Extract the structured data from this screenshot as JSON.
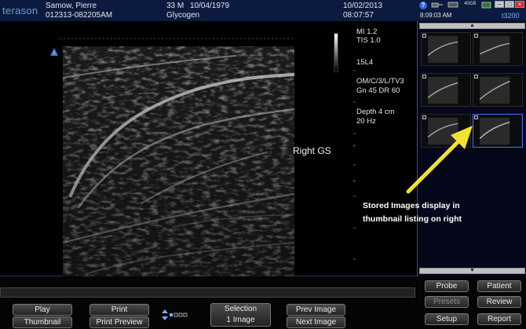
{
  "header": {
    "brand": "terason",
    "patient_name": "Samow, Pierre",
    "patient_id": "012313-082205AM",
    "age": "33 M",
    "dob": "10/04/1979",
    "study": "Glycogen",
    "date": "10/02/2013",
    "time": "08:07:57"
  },
  "status": {
    "clock": "8:09:03 AM",
    "disk": "40GB",
    "model": "t3200"
  },
  "params": {
    "mi": "MI  1.2",
    "tis": "TIS 1.0",
    "probe": "15L4",
    "mode": "OM/C/3/L/TV3",
    "gain": "Gn 45   DR 60",
    "depth": "Depth 4 cm",
    "rate": "20 Hz"
  },
  "annotation": "Right GS",
  "callout": "Stored Images display in thumbnail listing on right",
  "buttons": {
    "play": "Play",
    "thumbnail": "Thumbnail",
    "print": "Print",
    "print_preview": "Print Preview",
    "selection": "Selection",
    "selection_count": "1 Image",
    "prev_image": "Prev Image",
    "next_image": "Next Image",
    "probe": "Probe",
    "patient": "Patient",
    "presets": "Presets",
    "review": "Review",
    "setup": "Setup",
    "report": "Report"
  },
  "colors": {
    "header_bg": "#0b1a3e",
    "accent_blue": "#4a70ff",
    "callout_arrow": "#f2e230",
    "depth_marker": "#c040c0"
  }
}
